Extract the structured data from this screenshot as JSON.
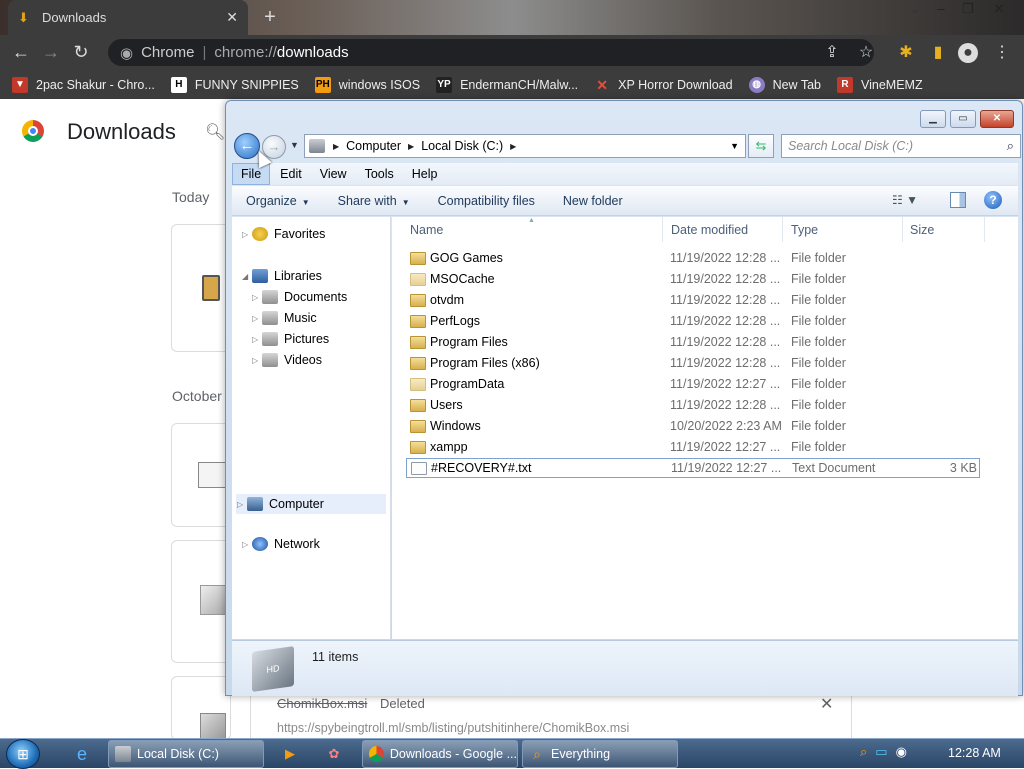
{
  "chrome": {
    "tab_title": "Downloads",
    "url_label": "Chrome",
    "url_scheme": "chrome://",
    "url_host": "downloads",
    "bookmarks": [
      {
        "label": "2pac Shakur - Chro...",
        "icon": "tshirt-icon",
        "color": "#c0392b"
      },
      {
        "label": "FUNNY SNIPPIES",
        "icon": "h-logo-icon",
        "color": "#ffffff"
      },
      {
        "label": "windows ISOS",
        "icon": "ph-logo-icon",
        "color": "#f39c12"
      },
      {
        "label": "EndermanCH/Malw...",
        "icon": "yp-logo-icon",
        "color": "#333333"
      },
      {
        "label": "XP Horror Download",
        "icon": "x-logo-icon",
        "color": "#e74c3c"
      },
      {
        "label": "New Tab",
        "icon": "globe-icon",
        "color": "#8e7cc3"
      },
      {
        "label": "VineMEMZ",
        "icon": "r-logo-icon",
        "color": "#c0392b"
      }
    ]
  },
  "downloads_page": {
    "title": "Downloads",
    "section_today": "Today",
    "section_october": "October",
    "deleted_name": "ChomikBox.msi",
    "deleted_status": "Deleted",
    "deleted_url": "https://spybeingtroll.ml/smb/listing/putshitinhere/ChomikBox.msi"
  },
  "explorer": {
    "breadcrumbs": [
      "Computer",
      "Local Disk (C:)"
    ],
    "search_placeholder": "Search Local Disk (C:)",
    "menu": [
      "File",
      "Edit",
      "View",
      "Tools",
      "Help"
    ],
    "commands": [
      {
        "label": "Organize",
        "dropdown": true
      },
      {
        "label": "Share with",
        "dropdown": true
      },
      {
        "label": "Compatibility files",
        "dropdown": false
      },
      {
        "label": "New folder",
        "dropdown": false
      }
    ],
    "nav": {
      "favorites": "Favorites",
      "libraries": "Libraries",
      "documents": "Documents",
      "music": "Music",
      "pictures": "Pictures",
      "videos": "Videos",
      "computer": "Computer",
      "network": "Network"
    },
    "columns": {
      "name": "Name",
      "date": "Date modified",
      "type": "Type",
      "size": "Size"
    },
    "files": [
      {
        "name": "GOG Games",
        "date": "11/19/2022 12:28 ...",
        "type": "File folder",
        "size": ""
      },
      {
        "name": "MSOCache",
        "date": "11/19/2022 12:28 ...",
        "type": "File folder",
        "size": ""
      },
      {
        "name": "otvdm",
        "date": "11/19/2022 12:28 ...",
        "type": "File folder",
        "size": ""
      },
      {
        "name": "PerfLogs",
        "date": "11/19/2022 12:28 ...",
        "type": "File folder",
        "size": ""
      },
      {
        "name": "Program Files",
        "date": "11/19/2022 12:28 ...",
        "type": "File folder",
        "size": ""
      },
      {
        "name": "Program Files (x86)",
        "date": "11/19/2022 12:28 ...",
        "type": "File folder",
        "size": ""
      },
      {
        "name": "ProgramData",
        "date": "11/19/2022 12:27 ...",
        "type": "File folder",
        "size": ""
      },
      {
        "name": "Users",
        "date": "11/19/2022 12:28 ...",
        "type": "File folder",
        "size": ""
      },
      {
        "name": "Windows",
        "date": "10/20/2022 2:23 AM",
        "type": "File folder",
        "size": ""
      },
      {
        "name": "xampp",
        "date": "11/19/2022 12:27 ...",
        "type": "File folder",
        "size": ""
      },
      {
        "name": "#RECOVERY#.txt",
        "date": "11/19/2022 12:27 ...",
        "type": "Text Document",
        "size": "3 KB"
      }
    ],
    "item_count": "11 items"
  },
  "taskbar": {
    "tasks": [
      "Local Disk (C:)",
      "Downloads - Google ...",
      "Everything"
    ],
    "clock": "12:28 AM"
  }
}
